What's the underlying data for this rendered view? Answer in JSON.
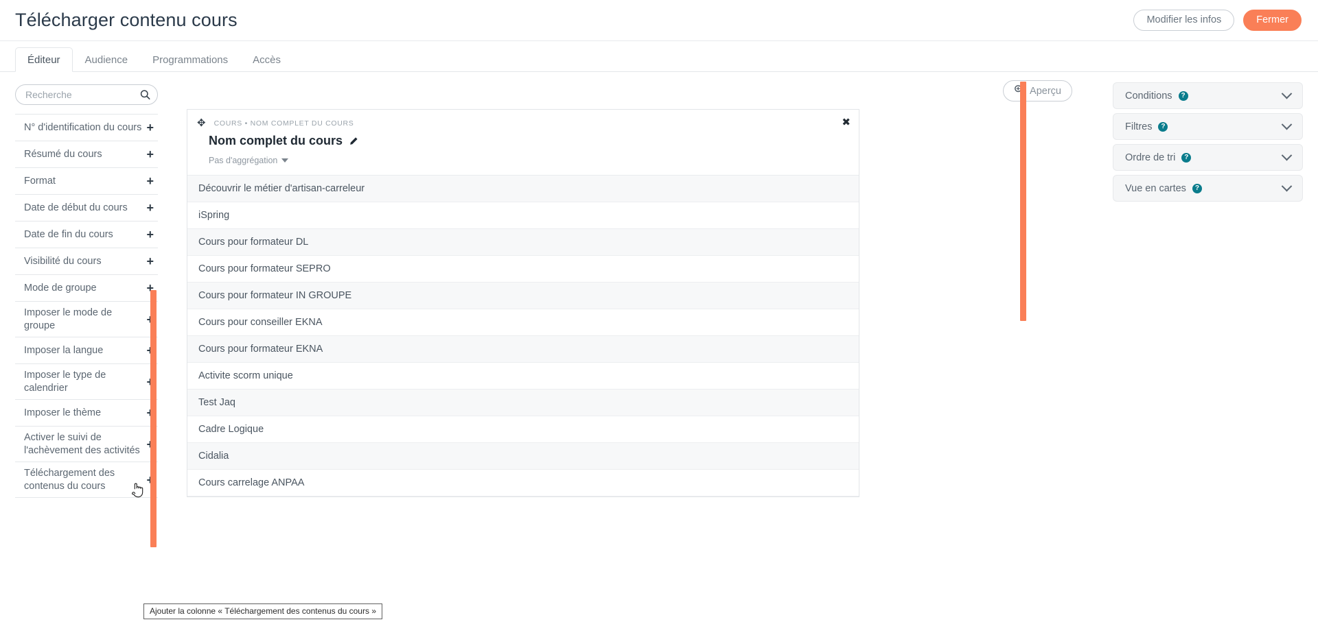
{
  "header": {
    "title": "Télécharger contenu cours",
    "buttons": [
      {
        "label": "Modifier les infos",
        "style": "secondary"
      },
      {
        "label": "Fermer",
        "style": "primary"
      }
    ],
    "accent_color": "#fa7f57"
  },
  "tabs": [
    {
      "label": "Éditeur",
      "active": true
    },
    {
      "label": "Audience",
      "active": false
    },
    {
      "label": "Programmations",
      "active": false
    },
    {
      "label": "Accès",
      "active": false
    }
  ],
  "sidebar": {
    "search": {
      "placeholder": "Recherche",
      "value": "",
      "icon": "search-icon"
    },
    "add_icon": "+",
    "items": [
      {
        "label": "N° d'identification du cours"
      },
      {
        "label": "Résumé du cours"
      },
      {
        "label": "Format"
      },
      {
        "label": "Date de début du cours"
      },
      {
        "label": "Date de fin du cours"
      },
      {
        "label": "Visibilité du cours"
      },
      {
        "label": "Mode de groupe"
      },
      {
        "label": "Imposer le mode de groupe"
      },
      {
        "label": "Imposer la langue"
      },
      {
        "label": "Imposer le type de calendrier"
      },
      {
        "label": "Imposer le thème"
      },
      {
        "label": "Activer le suivi de l'achèvement des activités"
      },
      {
        "label": "Téléchargement des contenus du cours"
      }
    ]
  },
  "center": {
    "preview_button": {
      "label": "Aperçu",
      "icon": "zoom-in-icon"
    },
    "column": {
      "breadcrumb": "COURS • NOM COMPLET DU COURS",
      "title": "Nom complet du cours",
      "edit_icon": "pencil-icon",
      "close_icon": "close-icon",
      "drag_icon": "move-icon",
      "aggregation": "Pas d'aggrégation"
    },
    "rows": [
      "Découvrir le métier d'artisan-carreleur",
      "iSpring",
      "Cours pour formateur DL",
      "Cours pour formateur SEPRO",
      "Cours pour formateur IN GROUPE",
      "Cours pour conseiller EKNA",
      "Cours pour formateur EKNA",
      "Activite scorm unique",
      "Test Jaq",
      "Cadre Logique",
      "Cidalia",
      "Cours carrelage ANPAA"
    ]
  },
  "right_panel": {
    "sections": [
      {
        "label": "Conditions",
        "help_icon": "help-icon",
        "chevron": "chevron-down-icon"
      },
      {
        "label": "Filtres",
        "help_icon": "help-icon",
        "chevron": "chevron-down-icon"
      },
      {
        "label": "Ordre de tri",
        "help_icon": "help-icon",
        "chevron": "chevron-down-icon"
      },
      {
        "label": "Vue en cartes",
        "help_icon": "help-icon",
        "chevron": "chevron-down-icon"
      }
    ],
    "help_color": "#0a7c8c"
  },
  "tooltip": {
    "text": "Ajouter la colonne « Téléchargement des contenus du cours »"
  }
}
